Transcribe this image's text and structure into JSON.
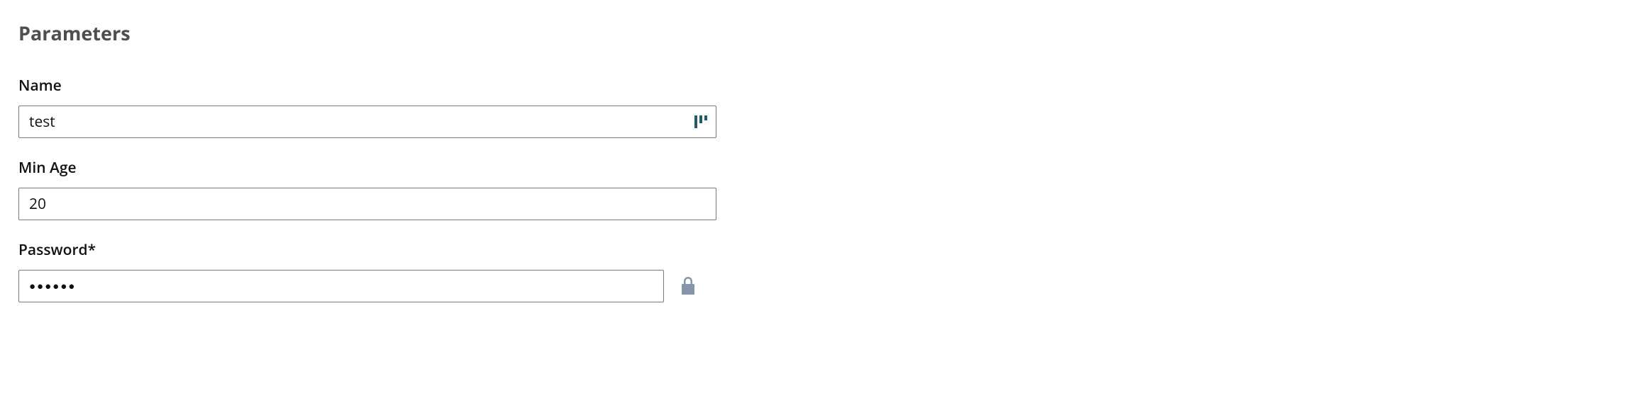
{
  "section": {
    "title": "Parameters"
  },
  "fields": {
    "name": {
      "label": "Name",
      "value": "test"
    },
    "minAge": {
      "label": "Min Age",
      "value": "20"
    },
    "password": {
      "label": "Password*",
      "value": "●●●●●●"
    }
  },
  "icons": {
    "name_inner": "dashboard-icon",
    "lock": "lock-icon"
  },
  "colors": {
    "heading": "#4f4f4f",
    "border": "#7a7a7a",
    "accent": "#205a70",
    "lock": "#8795aa"
  }
}
